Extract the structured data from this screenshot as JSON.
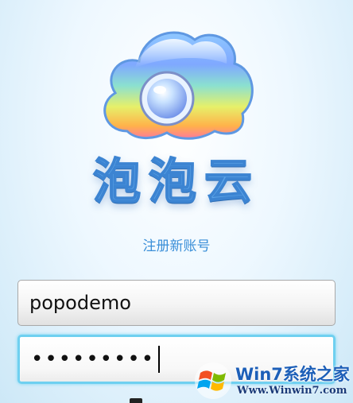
{
  "app": {
    "title": "泡泡云",
    "register_link": "注册新账号"
  },
  "form": {
    "username_value": "popodemo",
    "password_masked": "•••••••••"
  },
  "watermark": {
    "brand": "Win7系统之家",
    "url": "Www.Winwin7.com"
  },
  "icons": {
    "logo": "bubble-cloud-logo-icon",
    "watermark": "windows-flag-icon"
  },
  "colors": {
    "accent": "#3b8fd8",
    "focus_border": "#6fd0f0"
  }
}
